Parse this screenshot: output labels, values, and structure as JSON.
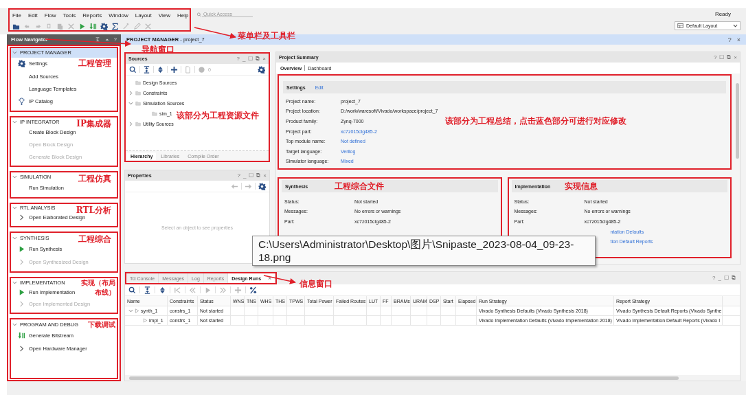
{
  "menu": [
    "File",
    "Edit",
    "Flow",
    "Tools",
    "Reports",
    "Window",
    "Layout",
    "View",
    "Help"
  ],
  "toolbar": [
    {
      "kind": "folder",
      "disabled": false
    },
    {
      "kind": "undo",
      "disabled": true
    },
    {
      "kind": "redo",
      "disabled": true
    },
    {
      "kind": "copy",
      "disabled": true
    },
    {
      "kind": "paste",
      "disabled": true
    },
    {
      "kind": "delete",
      "disabled": true
    },
    {
      "kind": "run",
      "disabled": false
    },
    {
      "kind": "bitstream",
      "disabled": false
    },
    {
      "kind": "gear",
      "disabled": false
    },
    {
      "kind": "sigma",
      "disabled": false
    },
    {
      "kind": "wand",
      "disabled": true
    },
    {
      "kind": "pencil",
      "disabled": true
    },
    {
      "kind": "cross",
      "disabled": true
    }
  ],
  "toolbar_note": "菜单栏及工具栏",
  "quick_access": {
    "placeholder": "Quick Access"
  },
  "status": "Ready",
  "layout_select": {
    "value": "Default Layout"
  },
  "flow_navigator": {
    "title": "Flow Navigator",
    "buttons": [
      "?"
    ],
    "note": "导航窗口",
    "sections": [
      {
        "title": "PROJECT MANAGER",
        "selected": true,
        "expanded": true,
        "note": "工程管理",
        "items": [
          {
            "label": "Settings",
            "kind": "gear",
            "disabled": false
          },
          {
            "label": "Add Sources",
            "kind": "none",
            "disabled": false
          },
          {
            "label": "Language Templates",
            "kind": "none",
            "disabled": false
          },
          {
            "label": "IP Catalog",
            "kind": "pin",
            "disabled": false
          }
        ]
      },
      {
        "title": "IP INTEGRATOR",
        "selected": false,
        "expanded": true,
        "note": "IP集成器",
        "items": [
          {
            "label": "Create Block Design",
            "kind": "none",
            "disabled": false
          },
          {
            "label": "Open Block Design",
            "kind": "none",
            "disabled": true
          },
          {
            "label": "Generate Block Design",
            "kind": "none",
            "disabled": true
          }
        ]
      },
      {
        "title": "SIMULATION",
        "selected": false,
        "expanded": true,
        "note": "工程仿真",
        "items": [
          {
            "label": "Run Simulation",
            "kind": "none",
            "disabled": false
          }
        ]
      },
      {
        "title": "RTL ANALYSIS",
        "selected": false,
        "expanded": true,
        "note": "RTL分析",
        "items": [
          {
            "label": "Open Elaborated Design",
            "kind": "chevron",
            "disabled": false
          }
        ]
      },
      {
        "title": "SYNTHESIS",
        "selected": false,
        "expanded": true,
        "note": "工程综合",
        "items": [
          {
            "label": "Run Synthesis",
            "kind": "run",
            "disabled": false
          },
          {
            "label": "Open Synthesized Design",
            "kind": "chevron",
            "disabled": true
          }
        ]
      },
      {
        "title": "IMPLEMENTATION",
        "selected": false,
        "expanded": true,
        "note": "实现（布局布线）",
        "items": [
          {
            "label": "Run Implementation",
            "kind": "run",
            "disabled": false
          },
          {
            "label": "Open Implemented Design",
            "kind": "chevron",
            "disabled": true
          }
        ]
      },
      {
        "title": "PROGRAM AND DEBUG",
        "selected": false,
        "expanded": true,
        "note": "下载调试",
        "items": [
          {
            "label": "Generate Bitstream",
            "kind": "bitstream",
            "disabled": false
          },
          {
            "label": "Open Hardware Manager",
            "kind": "chevron",
            "disabled": false
          }
        ]
      }
    ]
  },
  "breadcrumb": {
    "text": "**PROJECT MANAGER** - project_7",
    "buttons": [
      "?",
      "×"
    ]
  },
  "sources": {
    "title": "Sources",
    "buttons": [
      "?",
      "_",
      "☐",
      "⧉",
      "×"
    ],
    "count": "0",
    "note": "该部分为工程资源文件",
    "tree": [
      {
        "label": "Design Sources"
      },
      {
        "label": "Constraints",
        "expanded": false
      },
      {
        "label": "Simulation Sources",
        "expanded": true,
        "children": [
          {
            "label": "sim_1"
          }
        ]
      },
      {
        "label": "Utility Sources",
        "expanded": false
      }
    ],
    "tabs": [
      {
        "label": "Hierarchy",
        "selected": true
      },
      {
        "label": "Libraries",
        "selected": false
      },
      {
        "label": "Compile Order",
        "selected": false
      }
    ]
  },
  "properties": {
    "title": "Properties",
    "buttons": [
      "?",
      "_",
      "☐",
      "⧉",
      "×"
    ],
    "message": "Select an object to see properties"
  },
  "project_summary": {
    "title": "Project Summary",
    "buttons": [
      "?",
      "☐",
      "⧉",
      "×"
    ],
    "tabs": [
      {
        "label": "Overview",
        "selected": true
      },
      {
        "label": "Dashboard",
        "selected": false
      }
    ],
    "settings": {
      "title": "Settings",
      "edit": "Edit",
      "note": "该部分为工程总结，点击蓝色部分可进行对应修改",
      "rows": [
        {
          "label": "Project name:",
          "value": "project_7",
          "link": false
        },
        {
          "label": "Project location:",
          "value": "D:/work/waresoft/Vivado/workspace/project_7",
          "link": false
        },
        {
          "label": "Product family:",
          "value": "Zynq-7000",
          "link": false
        },
        {
          "label": "Project part:",
          "value": "xc7z015clg485-2",
          "link": true
        },
        {
          "label": "Top module name:",
          "value": "Not defined",
          "link": true
        },
        {
          "label": "Target language:",
          "value": "Verilog",
          "link": true
        },
        {
          "label": "Simulator language:",
          "value": "Mixed",
          "link": true
        }
      ]
    },
    "synthesis": {
      "title": "Synthesis",
      "note": "工程综合文件",
      "rows": [
        {
          "label": "Status:",
          "value": "Not started",
          "link": false
        },
        {
          "label": "Messages:",
          "value": "No errors or warnings",
          "link": false
        },
        {
          "label": "Part:",
          "value": "xc7z015clg485-2",
          "link": false
        }
      ]
    },
    "implementation": {
      "title": "Implementation",
      "note": "实现信息",
      "rows": [
        {
          "label": "Status:",
          "value": "Not started",
          "link": false
        },
        {
          "label": "Messages:",
          "value": "No errors or warnings",
          "link": false
        },
        {
          "label": "Part:",
          "value": "xc7z015clg485-2",
          "link": false
        },
        {
          "value": "ntation Defaults",
          "link": true
        },
        {
          "value": "tion Default Reports",
          "link": true
        }
      ]
    }
  },
  "runs": {
    "note": "信息窗口",
    "buttons": [
      "?",
      "_",
      "☐",
      "⧉"
    ],
    "tabs": [
      {
        "label": "Tcl Console",
        "selected": false,
        "closable": false
      },
      {
        "label": "Messages",
        "selected": false,
        "closable": false
      },
      {
        "label": "Log",
        "selected": false,
        "closable": false
      },
      {
        "label": "Reports",
        "selected": false,
        "closable": false
      },
      {
        "label": "Design Runs",
        "selected": true,
        "closable": true
      }
    ],
    "close": "×",
    "toolbar": [
      {
        "kind": "search",
        "disabled": false
      },
      {
        "kind": "collapse",
        "disabled": false
      },
      {
        "kind": "expand",
        "disabled": false
      },
      {
        "kind": "first",
        "disabled": true
      },
      {
        "kind": "prev",
        "disabled": true
      },
      {
        "kind": "play",
        "disabled": true
      },
      {
        "kind": "next",
        "disabled": true
      },
      {
        "kind": "plus",
        "disabled": true
      },
      {
        "kind": "percent",
        "disabled": false
      }
    ],
    "columns": [
      "Name",
      "Constraints",
      "Status",
      "WNS",
      "TNS",
      "WHS",
      "THS",
      "TPWS",
      "Total Power",
      "Failed Routes",
      "LUT",
      "FF",
      "BRAMs",
      "URAM",
      "DSP",
      "Start",
      "Elapsed",
      "Run Strategy",
      "Report Strategy"
    ],
    "rows": [
      {
        "cells": [
          "synth_1",
          "constrs_1",
          "Not started",
          "",
          "",
          "",
          "",
          "",
          "",
          "",
          "",
          "",
          "",
          "",
          "",
          "",
          "",
          "Vivado Synthesis Defaults (Vivado Synthesis 2018)",
          "Vivado Synthesis Default Reports (Vivado Synthe"
        ],
        "expanded": true,
        "children": [
          {
            "cells": [
              "impl_1",
              "constrs_1",
              "Not started",
              "",
              "",
              "",
              "",
              "",
              "",
              "",
              "",
              "",
              "",
              "",
              "",
              "",
              "",
              "Vivado Implementation Defaults (Vivado Implementation 2018)",
              "Vivado Implementation Default Reports (Vivado I"
            ]
          }
        ]
      }
    ]
  },
  "tooltip": "C:\\Users\\Administrator\\Desktop\\图片\\Snipaste_2023-08-04_09-23-18.png"
}
